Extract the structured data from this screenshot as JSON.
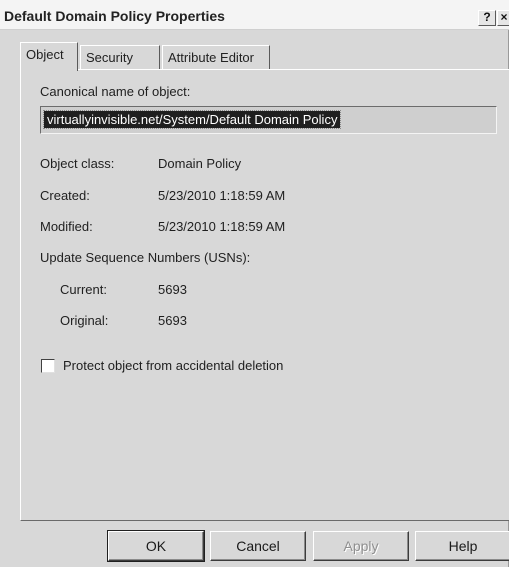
{
  "window": {
    "title": "Default Domain Policy Properties",
    "help_glyph": "?",
    "close_glyph": "×"
  },
  "tabs": [
    {
      "label": "Object",
      "active": true
    },
    {
      "label": "Security",
      "active": false
    },
    {
      "label": "Attribute Editor",
      "active": false
    }
  ],
  "object": {
    "canonical_label": "Canonical name of object:",
    "canonical_value": "virtuallyinvisible.net/System/Default Domain Policy",
    "class_label": "Object class:",
    "class_value": "Domain Policy",
    "created_label": "Created:",
    "created_value": "5/23/2010 1:18:59 AM",
    "modified_label": "Modified:",
    "modified_value": "5/23/2010 1:18:59 AM",
    "usn_label": "Update Sequence Numbers (USNs):",
    "current_label": "Current:",
    "current_value": "5693",
    "original_label": "Original:",
    "original_value": "5693",
    "protect_label": "Protect object from accidental deletion",
    "protect_checked": false
  },
  "buttons": {
    "ok": "OK",
    "cancel": "Cancel",
    "apply": "Apply",
    "help": "Help"
  }
}
